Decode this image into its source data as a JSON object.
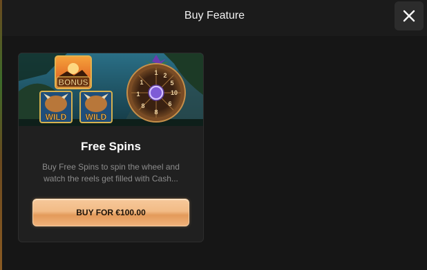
{
  "header": {
    "title": "Buy Feature"
  },
  "card": {
    "image_banner": {
      "bonus_label": "BONUS",
      "wild_label": "WILD",
      "wheel_numbers": [
        "1",
        "2",
        "5",
        "10",
        "6",
        "8",
        "8",
        "1",
        "1"
      ]
    },
    "title": "Free Spins",
    "description": "Buy Free Spins to spin the wheel and watch the reels get filled with Cash...",
    "buy_label": "BUY FOR €100.00"
  },
  "colors": {
    "background": "#161616",
    "card": "#202020",
    "button_gold": "#f2bb86",
    "wheel_center": "#7e5bd6"
  },
  "icons": {
    "close": "close-icon"
  }
}
